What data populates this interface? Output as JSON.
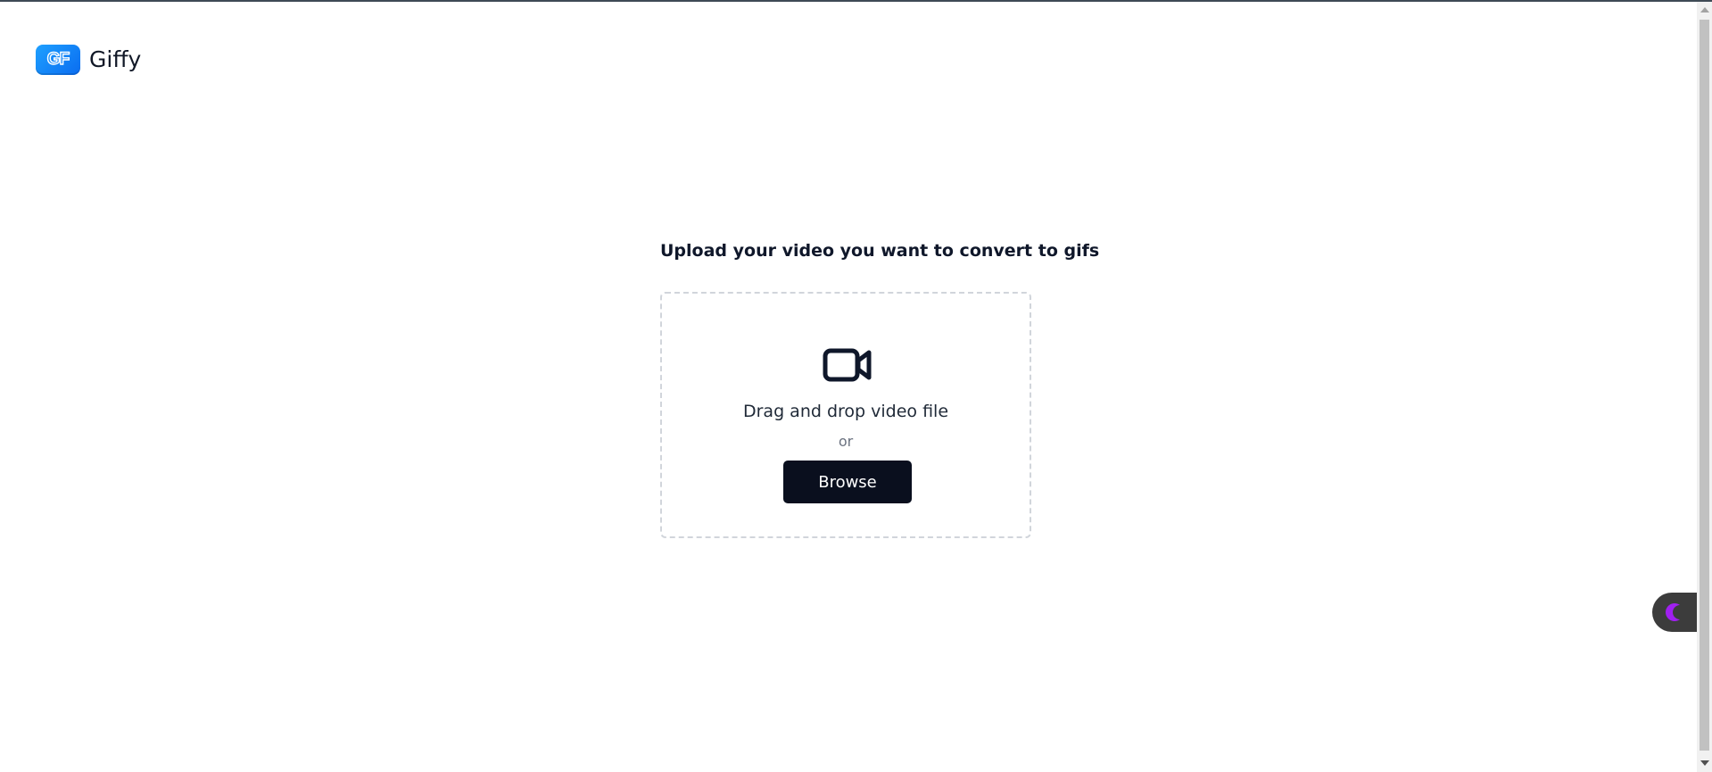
{
  "app": {
    "logo_initials": "GF",
    "name": "Giffy"
  },
  "upload": {
    "title": "Upload your video you want to convert to gifs",
    "drag_text": "Drag and drop video file",
    "or_text": "or",
    "browse_label": "Browse"
  },
  "icons": {
    "upload_icon": "video-camera-icon",
    "widget_icon": "moon-icon"
  },
  "colors": {
    "brand": "#0a84ff",
    "button_bg": "#0a0f1e",
    "widget_accent": "#a020f0"
  }
}
